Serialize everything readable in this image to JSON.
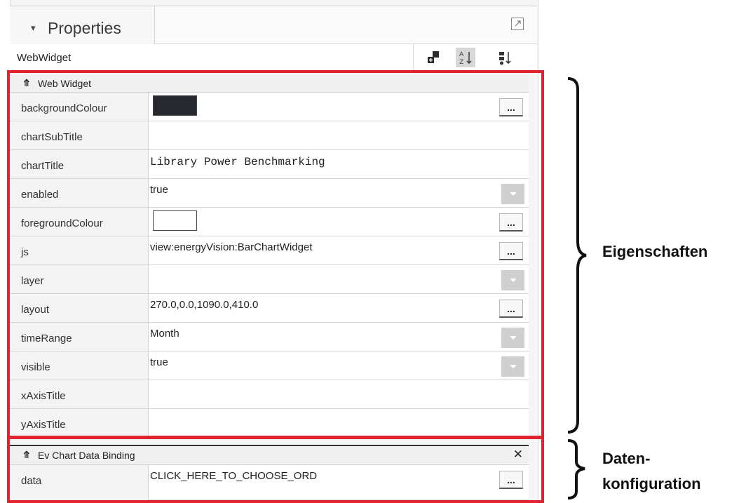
{
  "panel": {
    "tab_title": "Properties",
    "toolbar_title": "WebWidget"
  },
  "sections": {
    "web_widget": "Web Widget",
    "ev_binding": "Ev Chart Data Binding"
  },
  "properties": [
    {
      "key": "backgroundColour",
      "value": "",
      "control": "button",
      "swatch": "#25282e"
    },
    {
      "key": "chartSubTitle",
      "value": "",
      "control": "none"
    },
    {
      "key": "chartTitle",
      "value": "Library Power Benchmarking",
      "control": "none"
    },
    {
      "key": "enabled",
      "value": "true",
      "control": "dropdown"
    },
    {
      "key": "foregroundColour",
      "value": "",
      "control": "button",
      "swatch": "#ffffff"
    },
    {
      "key": "js",
      "value": "view:energyVision:BarChartWidget",
      "control": "button"
    },
    {
      "key": "layer",
      "value": "",
      "control": "dropdown"
    },
    {
      "key": "layout",
      "value": "270.0,0.0,1090.0,410.0",
      "control": "button"
    },
    {
      "key": "timeRange",
      "value": "Month",
      "control": "dropdown"
    },
    {
      "key": "visible",
      "value": "true",
      "control": "dropdown"
    },
    {
      "key": "xAxisTitle",
      "value": "",
      "control": "none"
    },
    {
      "key": "yAxisTitle",
      "value": "",
      "control": "none"
    }
  ],
  "binding": {
    "key": "data",
    "value": "CLICK_HERE_TO_CHOOSE_ORD",
    "button": "..."
  },
  "button_label": "...",
  "annotations": {
    "eigenschaften": "Eigenschaften",
    "daten_line1": "Daten-",
    "daten_line2": "konfiguration"
  },
  "colors": {
    "highlight": "#e0242f"
  }
}
